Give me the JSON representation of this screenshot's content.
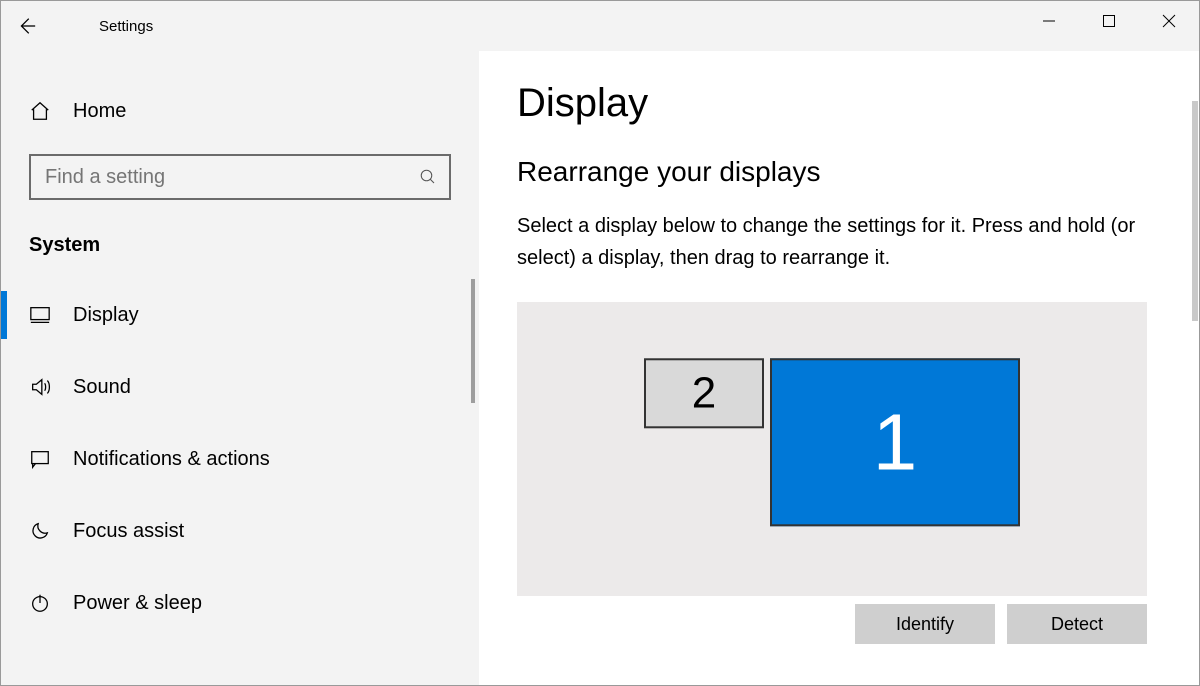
{
  "window": {
    "title": "Settings"
  },
  "sidebar": {
    "home": "Home",
    "search_placeholder": "Find a setting",
    "section": "System",
    "items": [
      {
        "label": "Display",
        "icon": "monitor-icon",
        "active": true
      },
      {
        "label": "Sound",
        "icon": "speaker-icon",
        "active": false
      },
      {
        "label": "Notifications & actions",
        "icon": "chat-icon",
        "active": false
      },
      {
        "label": "Focus assist",
        "icon": "moon-icon",
        "active": false
      },
      {
        "label": "Power & sleep",
        "icon": "power-icon",
        "active": false
      }
    ]
  },
  "main": {
    "title": "Display",
    "subhead": "Rearrange your displays",
    "description": "Select a display below to change the settings for it. Press and hold (or select) a display, then drag to rearrange it.",
    "monitors": {
      "primary": "1",
      "secondary": "2"
    },
    "buttons": {
      "identify": "Identify",
      "detect": "Detect"
    }
  }
}
